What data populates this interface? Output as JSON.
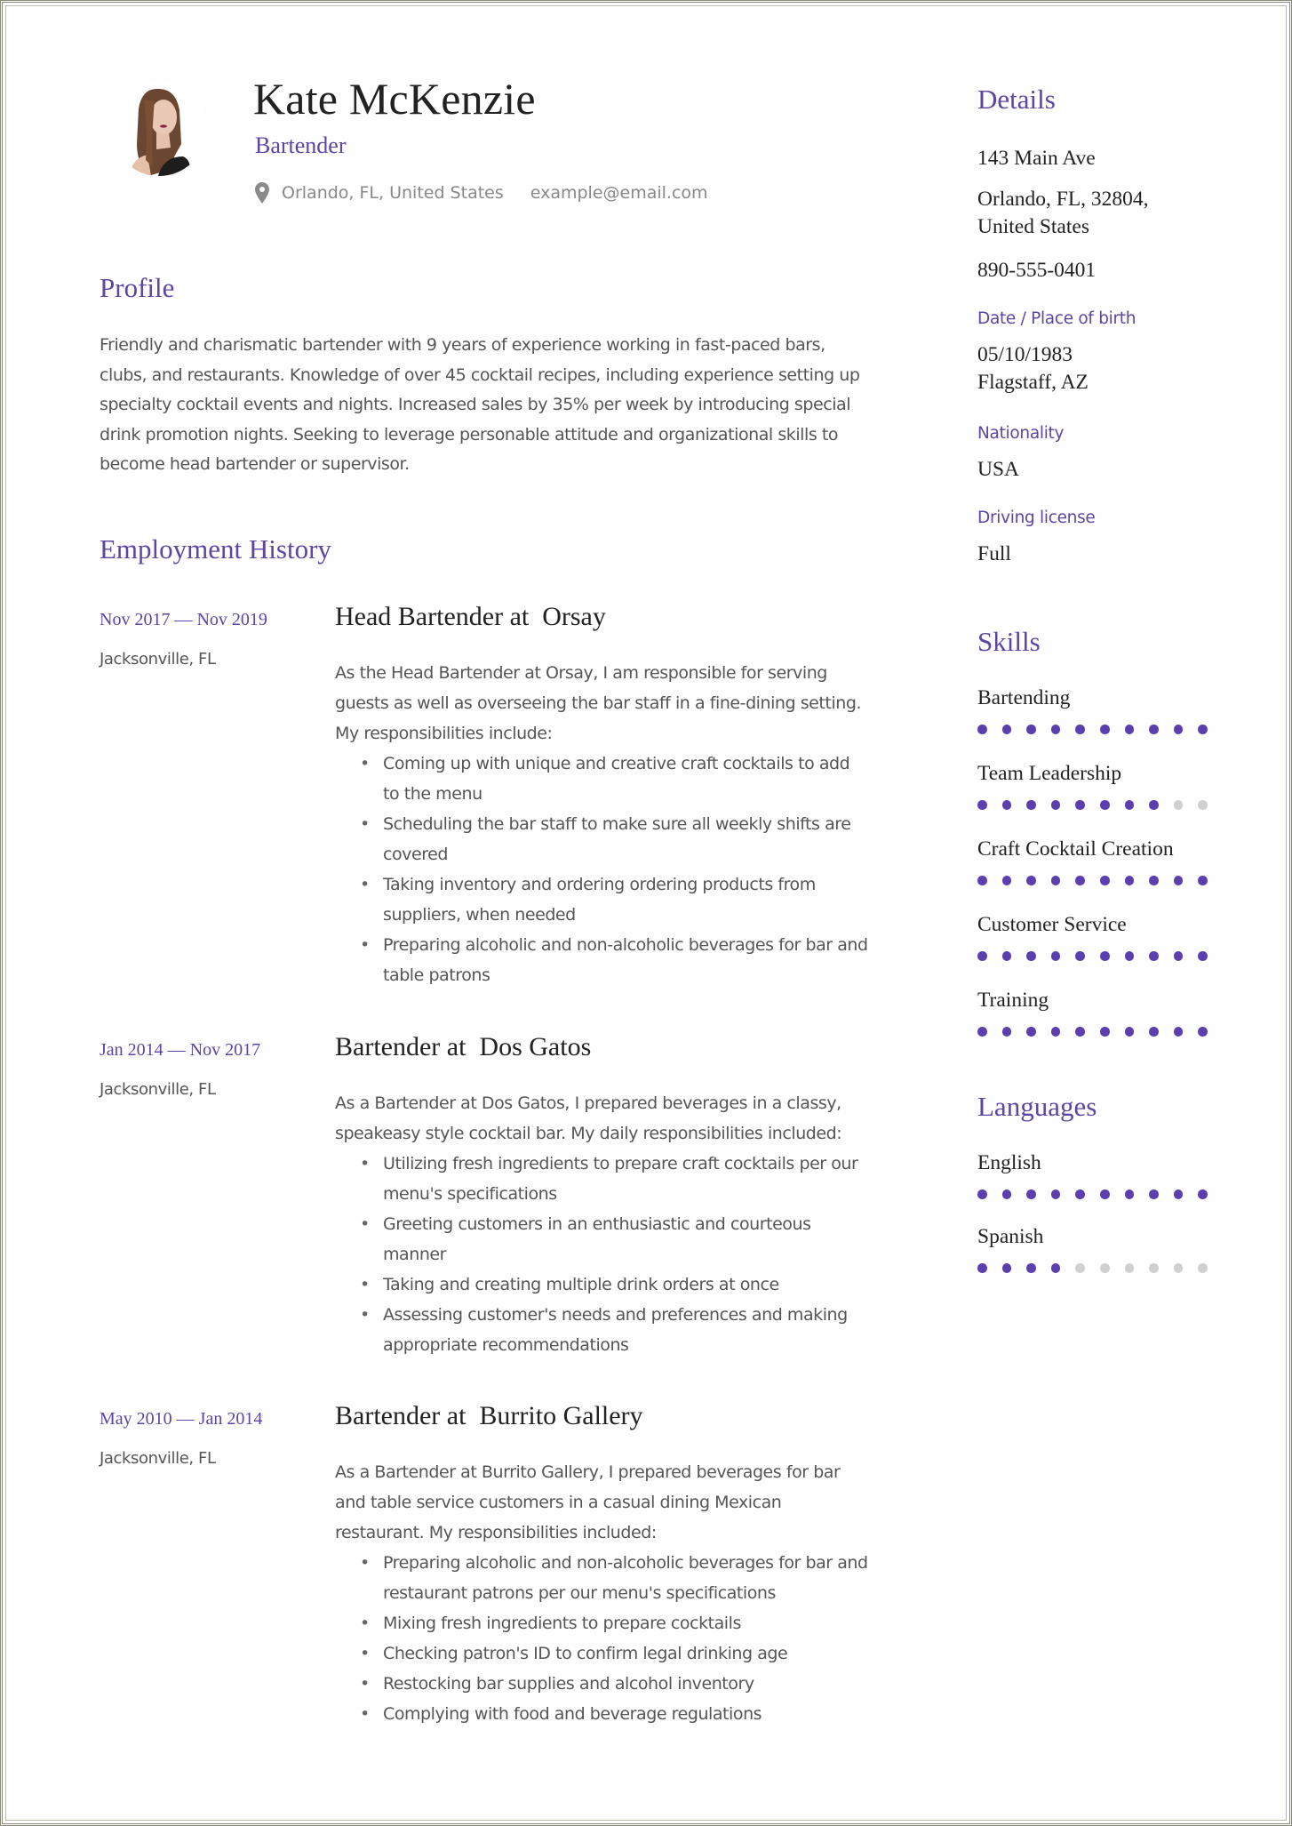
{
  "header": {
    "name": "Kate McKenzie",
    "job_title": "Bartender",
    "location": "Orlando, FL, United States",
    "email": "example@email.com",
    "icons": {
      "location": "map-pin-icon",
      "avatar": "profile-photo"
    }
  },
  "profile": {
    "heading": "Profile",
    "text": "Friendly and charismatic bartender with 9 years of experience working in fast-paced bars, clubs, and restaurants. Knowledge of over 45 cocktail recipes, including experience setting up specialty cocktail events and nights. Increased sales by 35% per week by introducing special drink promotion nights. Seeking to leverage personable attitude and organizational skills to become head bartender or supervisor."
  },
  "employment": {
    "heading": "Employment History",
    "jobs": [
      {
        "dates": "Nov 2017 — Nov 2019",
        "location": "Jacksonville, FL",
        "title": "Head Bartender at  Orsay",
        "intro": "As the Head Bartender at Orsay, I am responsible for serving guests as well as overseeing the bar staff in a fine-dining setting. My responsibilities include:",
        "bullets": [
          "Coming up with unique and creative craft cocktails to add to the menu",
          "Scheduling the bar staff to make sure all weekly shifts are covered",
          "Taking inventory and ordering ordering products from suppliers, when needed",
          "Preparing alcoholic and non-alcoholic beverages for bar and table patrons"
        ]
      },
      {
        "dates": "Jan 2014 — Nov 2017",
        "location": "Jacksonville, FL",
        "title": "Bartender at  Dos Gatos",
        "intro": "As a Bartender at Dos Gatos, I prepared beverages in a classy, speakeasy style cocktail bar. My daily responsibilities included:",
        "bullets": [
          "Utilizing fresh ingredients to prepare craft cocktails per our menu's specifications",
          "Greeting customers in an enthusiastic and courteous manner",
          "Taking and creating multiple drink orders at once",
          "Assessing customer's needs and preferences and making appropriate recommendations"
        ]
      },
      {
        "dates": "May 2010 — Jan 2014",
        "location": "Jacksonville, FL",
        "title": "Bartender at  Burrito Gallery",
        "intro": "As a Bartender at Burrito Gallery, I prepared beverages for bar and table service customers in a casual dining Mexican restaurant. My responsibilities included:",
        "bullets": [
          "Preparing alcoholic and non-alcoholic beverages for bar and restaurant patrons per our menu's specifications",
          "Mixing fresh ingredients to prepare cocktails",
          "Checking patron's ID to confirm legal drinking age",
          "Restocking bar supplies and alcohol inventory",
          "Complying with food and beverage regulations"
        ]
      }
    ]
  },
  "details": {
    "heading": "Details",
    "address_line1": "143 Main Ave",
    "address_line2": "Orlando, FL, 32804,",
    "address_line3": "United States",
    "phone": "890-555-0401",
    "birth_label": "Date / Place of birth",
    "birth_date": "05/10/1983",
    "birth_place": "Flagstaff, AZ",
    "nationality_label": "Nationality",
    "nationality": "USA",
    "license_label": "Driving license",
    "license": "Full"
  },
  "skills": {
    "heading": "Skills",
    "max_level": 10,
    "items": [
      {
        "name": "Bartending",
        "level": 10
      },
      {
        "name": "Team Leadership",
        "level": 8
      },
      {
        "name": "Craft Cocktail Creation",
        "level": 10
      },
      {
        "name": "Customer Service",
        "level": 10
      },
      {
        "name": "Training",
        "level": 10
      }
    ]
  },
  "languages": {
    "heading": "Languages",
    "max_level": 10,
    "items": [
      {
        "name": "English",
        "level": 10
      },
      {
        "name": "Spanish",
        "level": 4
      }
    ]
  },
  "colors": {
    "accent": "#5c46a2",
    "dot_on": "#5b3fae",
    "dot_off": "#d0d0d0",
    "frame": "#8a8a7a"
  }
}
